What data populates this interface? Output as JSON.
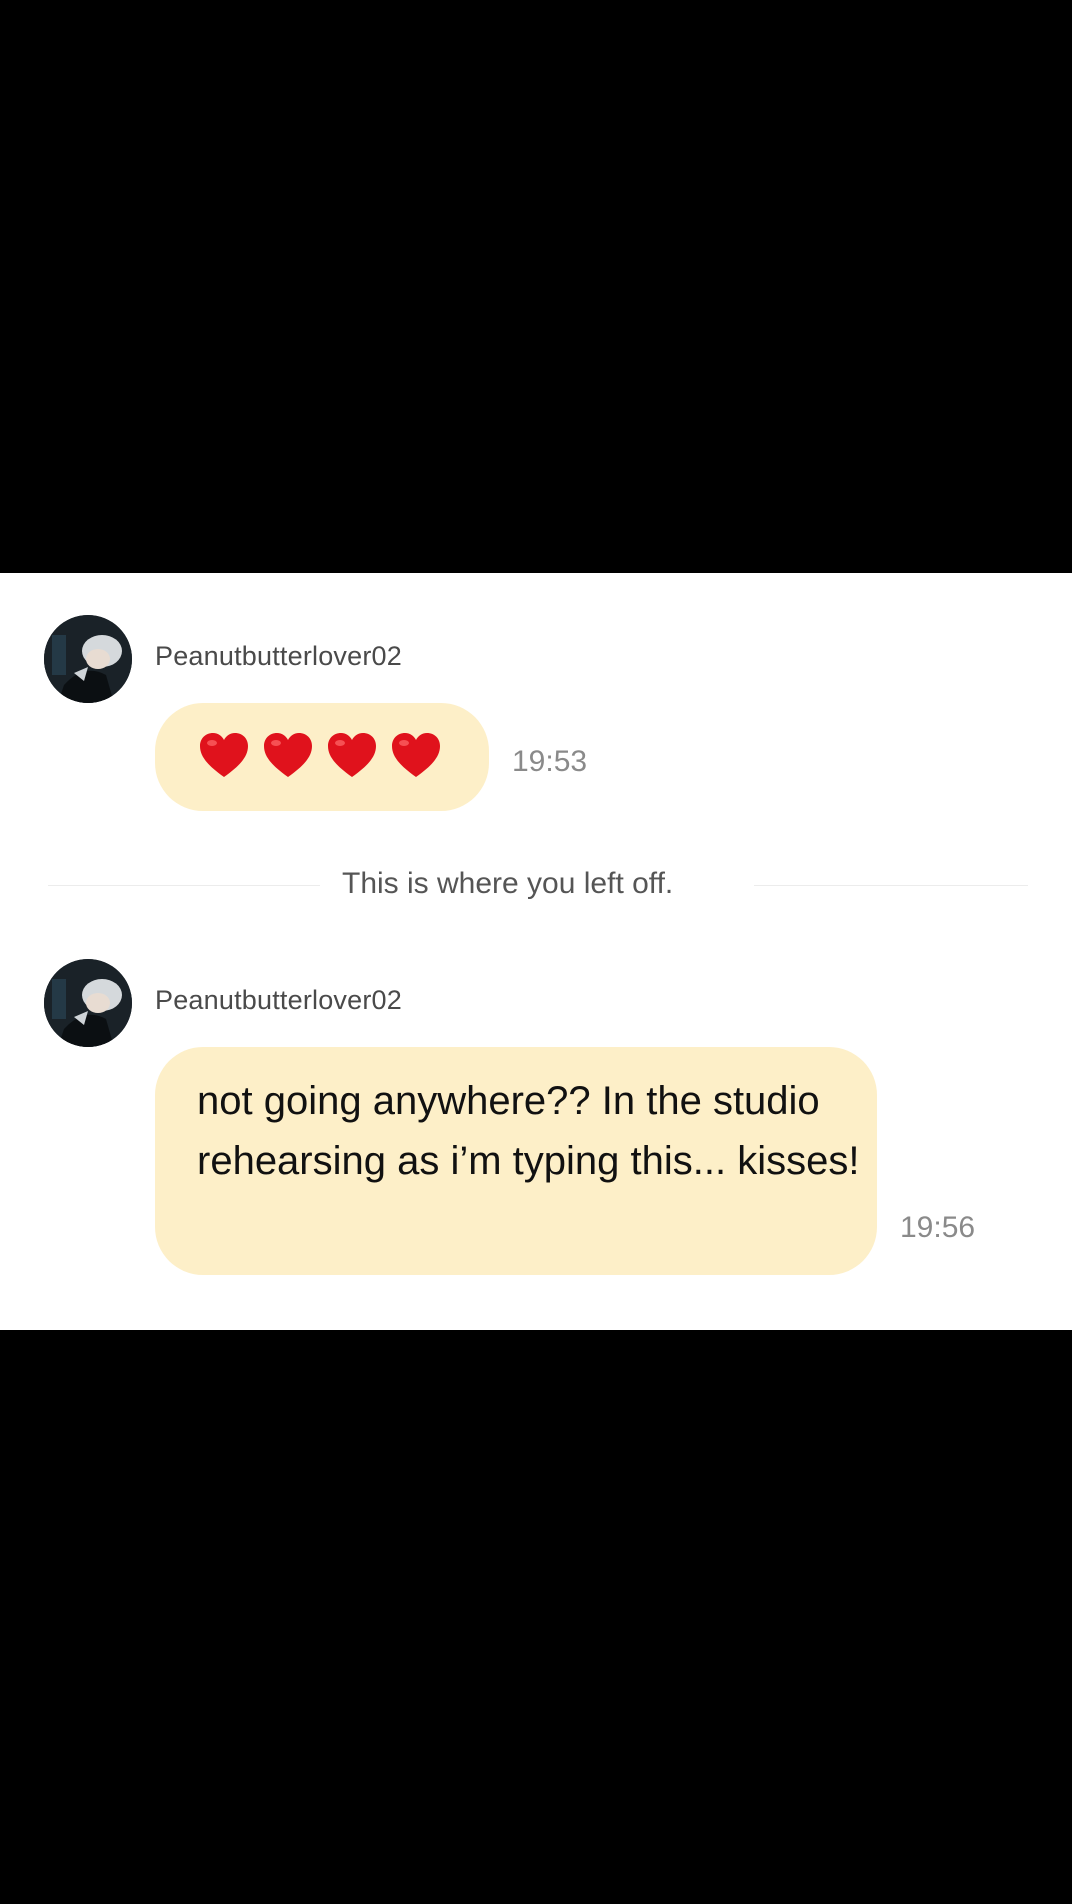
{
  "messages": [
    {
      "username": "Peanutbutterlover02",
      "content": "❤️❤️❤️❤️",
      "time": "19:53"
    },
    {
      "username": "Peanutbutterlover02",
      "content": "not going anywhere?? In the studio rehearsing as i’m typing this... kisses!",
      "time": "19:56"
    }
  ],
  "divider": {
    "label": "This is where you left off."
  },
  "colors": {
    "bubble": "#fdefc8",
    "heart": "#e0121c",
    "letterbox": "#000000"
  },
  "icons": {
    "avatar": "profile-avatar",
    "heart": "red-heart-emoji"
  }
}
